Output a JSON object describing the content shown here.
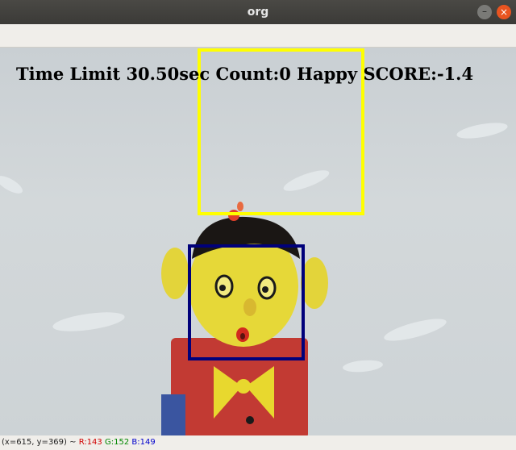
{
  "window": {
    "title": "org"
  },
  "overlay": {
    "hud_text": "Time Limit 30.50sec Count:0 Happy SCORE:-1.4",
    "colors": {
      "target_box": "#ffff00",
      "face_box": "#00007a"
    }
  },
  "status": {
    "coords": "(x=615, y=369) ~",
    "r": "R:143",
    "g": "G:152",
    "b": "B:149"
  },
  "icons": {
    "close": "close-icon",
    "minimize": "minimize-icon"
  }
}
